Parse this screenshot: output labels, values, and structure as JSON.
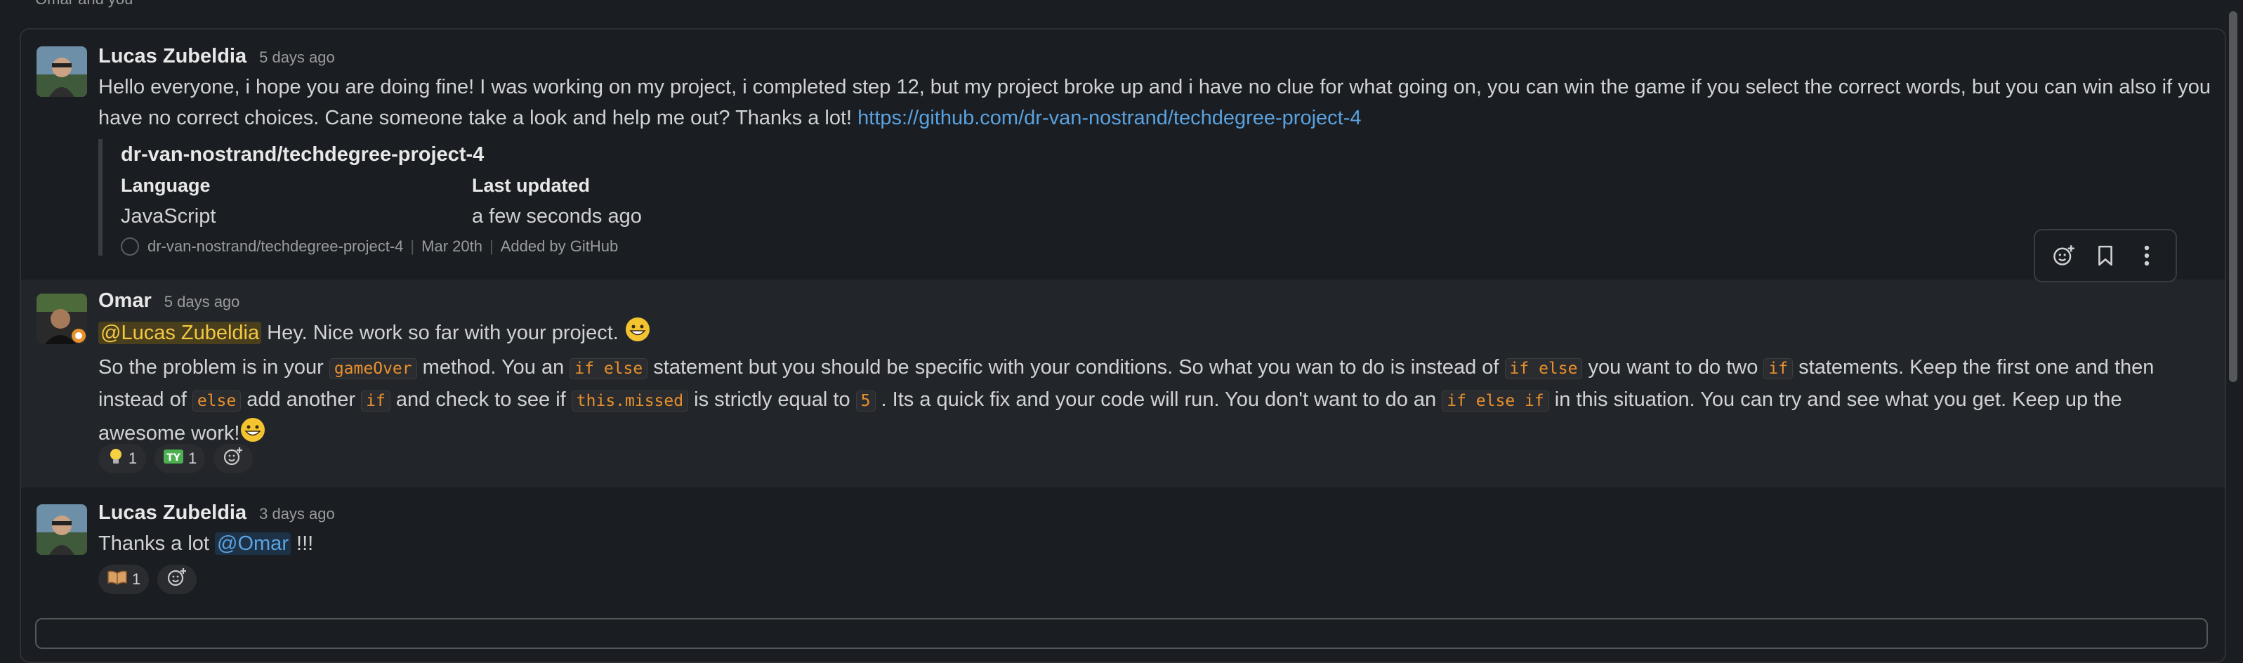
{
  "header_hint": "Omar and you",
  "messages": [
    {
      "author": "Lucas Zubeldia",
      "time": "5 days ago",
      "text_before_link": "Hello everyone, i hope you are doing fine! I was working on my project, i completed step 12, but my project broke up and i have no clue for what going on, you can win the game if you select the correct words, but you can win also if you have no correct choices. Cane someone take a look and help me out? Thanks a lot! ",
      "link": "https://github.com/dr-van-nostrand/techdegree-project-4",
      "unfurl": {
        "title": "dr-van-nostrand/techdegree-project-4",
        "language_label": "Language",
        "language_value": "JavaScript",
        "updated_label": "Last updated",
        "updated_value": "a few seconds ago",
        "footer_repo": "dr-van-nostrand/techdegree-project-4",
        "footer_date": "Mar 20th",
        "footer_added": "Added by GitHub"
      }
    },
    {
      "author": "Omar",
      "time": "5 days ago",
      "mention": "@Lucas Zubeldia",
      "line1": " Hey. Nice work so far with your project. ",
      "p1": "So the problem is in your ",
      "c1": "gameOver",
      "p2": " method. You an ",
      "c2": "if else",
      "p3": " statement but you should be specific with your conditions. So what you wan to do is instead of ",
      "c3": "if else",
      "p4": " you want to do two ",
      "c4": "if",
      "p5": " statements. Keep the first one and then instead of ",
      "c5": "else",
      "p6": " add another ",
      "c6": "if",
      "p7": " and check to see if ",
      "c7": "this.missed",
      "p8": " is strictly equal to ",
      "c8": "5",
      "p9": " . Its a quick fix and your code will run. You don't want to do an ",
      "c9": "if else if",
      "p10": " in this situation. You can try and see what you get. Keep up the awesome work!",
      "reactions": [
        {
          "icon": "lightbulb-icon",
          "count": "1"
        },
        {
          "icon": "ty-icon",
          "count": "1"
        }
      ]
    },
    {
      "author": "Lucas Zubeldia",
      "time": "3 days ago",
      "text_before": "Thanks a lot ",
      "mention": "@Omar",
      "text_after": " !!!",
      "reactions": [
        {
          "icon": "open-book-icon",
          "count": "1"
        }
      ]
    }
  ],
  "colors": {
    "background": "#1a1d21",
    "hover_row": "#222529",
    "link": "#5aa2e0",
    "code": "#e8912d",
    "mention_highlight": "#f2c744"
  }
}
